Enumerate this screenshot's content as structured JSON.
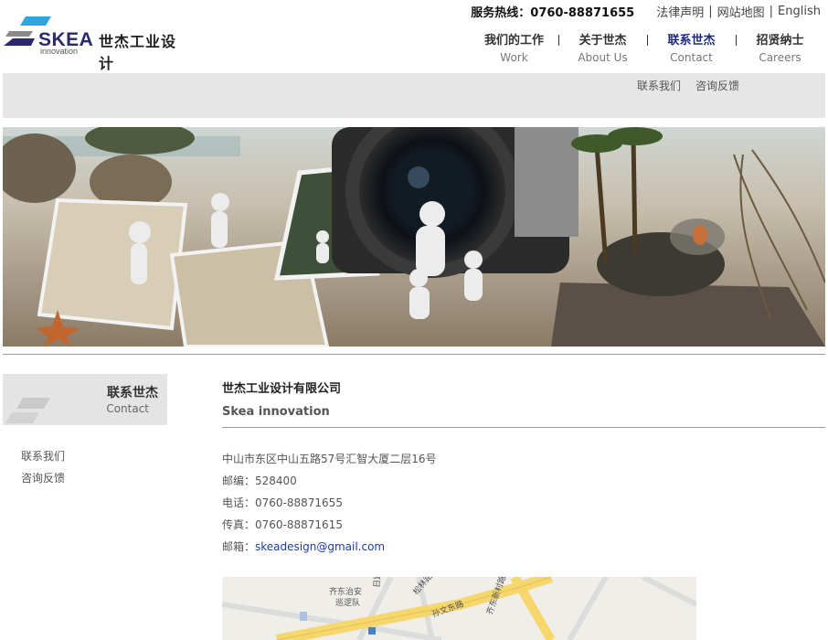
{
  "brand": {
    "logo_word": "SKEA",
    "logo_sub": "innovation",
    "logo_cn": "世杰工业设计",
    "colors": {
      "navy": "#2a2a6a",
      "cyan": "#2aa7e0",
      "gray": "#888888"
    }
  },
  "topbar": {
    "hotline": "服务热线：0760-88871655",
    "links": [
      "法律声明",
      "网站地图",
      "English"
    ]
  },
  "nav": [
    {
      "cn": "我们的工作",
      "en": "Work"
    },
    {
      "cn": "关于世杰",
      "en": "About Us"
    },
    {
      "cn": "联系世杰",
      "en": "Contact",
      "active": true
    },
    {
      "cn": "招贤纳士",
      "en": "Careers"
    }
  ],
  "subnav": [
    "联系我们",
    "咨询反馈"
  ],
  "sidebar": {
    "title_cn": "联系世杰",
    "title_en": "Contact",
    "items": [
      "联系我们",
      "咨询反馈"
    ]
  },
  "contact": {
    "company_cn": "世杰工业设计有限公司",
    "company_en": "Skea innovation",
    "address": "中山市东区中山五路57号汇智大厦二层16号",
    "postcode": "邮编：528400",
    "phone": "电话：0760-88871655",
    "fax": "传真：0760-88871615",
    "email_label": "邮箱：",
    "email": "skeadesign@gmail.com",
    "link_color": "#1e3aa8"
  },
  "map": {
    "labels": [
      "齐东治安",
      "巡逻队",
      "日路",
      "松林路",
      "孙文东路",
      "齐东新村路"
    ]
  }
}
